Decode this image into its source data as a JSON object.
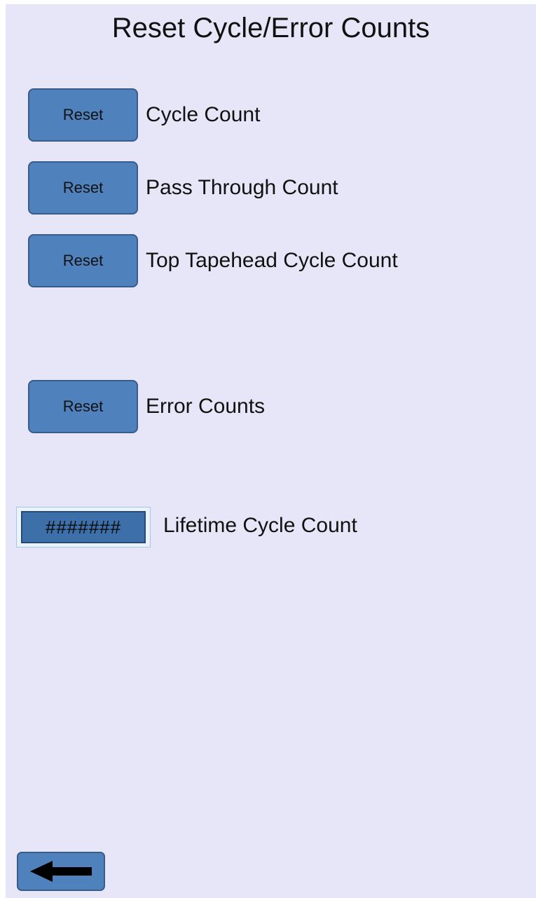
{
  "screen": {
    "title": "Reset Cycle/Error Counts"
  },
  "rows": [
    {
      "button_label": "Reset",
      "label": "Cycle Count"
    },
    {
      "button_label": "Reset",
      "label": "Pass Through Count"
    },
    {
      "button_label": "Reset",
      "label": "Top Tapehead Cycle Count"
    },
    {
      "button_label": "Reset",
      "label": "Error Counts"
    }
  ],
  "lifetime": {
    "value": "#######",
    "label": "Lifetime Cycle Count"
  },
  "navigation": {
    "back_icon": "left-arrow-icon"
  },
  "colors": {
    "background": "#e6e6f8",
    "button_fill": "#4f81bd",
    "button_border": "#385d8a",
    "field_fill": "#3d6fa8"
  }
}
